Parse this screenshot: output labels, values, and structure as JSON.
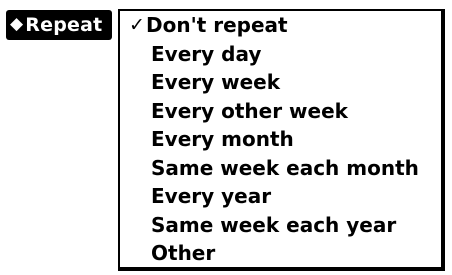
{
  "trigger": {
    "icon": "diamond-icon",
    "label": "Repeat"
  },
  "menu": {
    "selected_index": 0,
    "check_glyph": "✓",
    "items": [
      {
        "label": "Don't repeat"
      },
      {
        "label": "Every day"
      },
      {
        "label": "Every week"
      },
      {
        "label": "Every other week"
      },
      {
        "label": "Every month"
      },
      {
        "label": "Same week each month"
      },
      {
        "label": "Every year"
      },
      {
        "label": "Same week each year"
      },
      {
        "label": "Other"
      }
    ]
  }
}
